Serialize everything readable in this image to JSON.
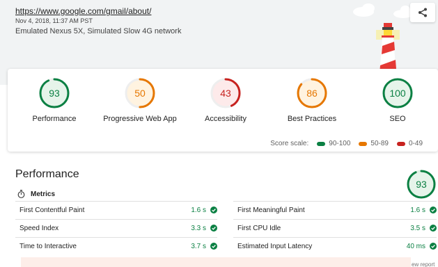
{
  "header": {
    "url": "https://www.google.com/gmail/about/",
    "date": "Nov 4, 2018, 11:37 AM PST",
    "environment": "Emulated Nexus 5X, Simulated Slow 4G network",
    "share_icon": "share-icon"
  },
  "colors": {
    "pass": "#0b8043",
    "average": "#e67700",
    "fail": "#c7221f",
    "header_bg": "#f1f3f4"
  },
  "scores": [
    {
      "label": "Performance",
      "score": "93",
      "level": "pass"
    },
    {
      "label": "Progressive Web App",
      "score": "50",
      "level": "average"
    },
    {
      "label": "Accessibility",
      "score": "43",
      "level": "fail"
    },
    {
      "label": "Best Practices",
      "score": "86",
      "level": "average"
    },
    {
      "label": "SEO",
      "score": "100",
      "level": "pass"
    }
  ],
  "scale": {
    "label": "Score scale:",
    "ranges": [
      "90-100",
      "50-89",
      "0-49"
    ]
  },
  "performance": {
    "title": "Performance",
    "score": "93",
    "metrics_label": "Metrics",
    "metrics_icon": "stopwatch-icon",
    "metrics": [
      {
        "name": "First Contentful Paint",
        "value": "1.6 s"
      },
      {
        "name": "First Meaningful Paint",
        "value": "1.6 s"
      },
      {
        "name": "Speed Index",
        "value": "3.3 s"
      },
      {
        "name": "First CPU Idle",
        "value": "3.5 s"
      },
      {
        "name": "Time to Interactive",
        "value": "3.7 s"
      },
      {
        "name": "Estimated Input Latency",
        "value": "40 ms"
      }
    ]
  },
  "footer": {
    "partial_text": "ew report"
  }
}
